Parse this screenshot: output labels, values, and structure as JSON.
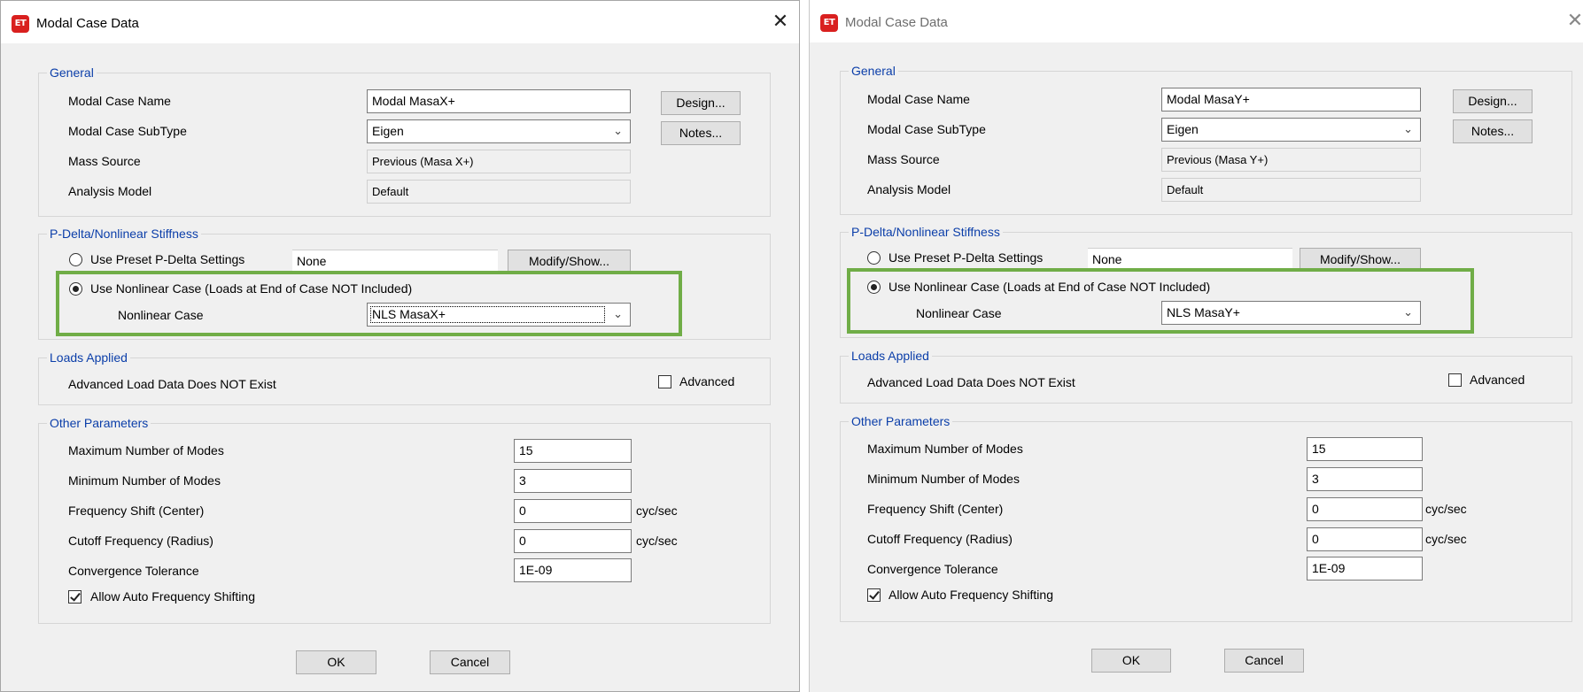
{
  "theme": {
    "legend_color": "#0b3ea9",
    "highlight_color": "#70ad47",
    "app_icon_color": "#d9201f"
  },
  "dialogs": [
    {
      "icon": "ET",
      "title": "Modal Case Data",
      "close": "✕",
      "general": {
        "legend": "General",
        "case_name_label": "Modal Case Name",
        "case_name": "Modal MasaX+",
        "subtype_label": "Modal Case SubType",
        "subtype": "Eigen",
        "mass_source_label": "Mass Source",
        "mass_source": "Previous  (Masa X+)",
        "analysis_model_label": "Analysis Model",
        "analysis_model": "Default",
        "design_button": "Design...",
        "notes_button": "Notes..."
      },
      "pdelta": {
        "legend": "P-Delta/Nonlinear Stiffness",
        "preset_label": "Use Preset P-Delta Settings",
        "preset_value": "None",
        "modify_button": "Modify/Show...",
        "nonlinear_label": "Use Nonlinear Case  (Loads at End of Case NOT Included)",
        "nonlinear_case_label": "Nonlinear Case",
        "nonlinear_case": "NLS MasaX+",
        "selected": "nonlinear"
      },
      "loads": {
        "legend": "Loads Applied",
        "status": "Advanced Load Data Does NOT Exist",
        "advanced_label": "Advanced",
        "advanced_checked": false
      },
      "other": {
        "legend": "Other Parameters",
        "max_modes_label": "Maximum Number of Modes",
        "max_modes": "15",
        "min_modes_label": "Minimum Number of Modes",
        "min_modes": "3",
        "freq_shift_label": "Frequency Shift  (Center)",
        "freq_shift": "0",
        "freq_shift_unit": "cyc/sec",
        "cutoff_label": "Cutoff Frequency  (Radius)",
        "cutoff": "0",
        "cutoff_unit": "cyc/sec",
        "tolerance_label": "Convergence Tolerance",
        "tolerance": "1E-09",
        "auto_shift_label": "Allow Auto Frequency Shifting",
        "auto_shift_checked": true
      },
      "ok_button": "OK",
      "cancel_button": "Cancel"
    },
    {
      "icon": "ET",
      "title": "Modal Case Data",
      "close": "✕",
      "general": {
        "legend": "General",
        "case_name_label": "Modal Case Name",
        "case_name": "Modal MasaY+",
        "subtype_label": "Modal Case SubType",
        "subtype": "Eigen",
        "mass_source_label": "Mass Source",
        "mass_source": "Previous  (Masa Y+)",
        "analysis_model_label": "Analysis Model",
        "analysis_model": "Default",
        "design_button": "Design...",
        "notes_button": "Notes..."
      },
      "pdelta": {
        "legend": "P-Delta/Nonlinear Stiffness",
        "preset_label": "Use Preset P-Delta Settings",
        "preset_value": "None",
        "modify_button": "Modify/Show...",
        "nonlinear_label": "Use Nonlinear Case  (Loads at End of Case NOT Included)",
        "nonlinear_case_label": "Nonlinear Case",
        "nonlinear_case": "NLS MasaY+",
        "selected": "nonlinear"
      },
      "loads": {
        "legend": "Loads Applied",
        "status": "Advanced Load Data Does NOT Exist",
        "advanced_label": "Advanced",
        "advanced_checked": false
      },
      "other": {
        "legend": "Other Parameters",
        "max_modes_label": "Maximum Number of Modes",
        "max_modes": "15",
        "min_modes_label": "Minimum Number of Modes",
        "min_modes": "3",
        "freq_shift_label": "Frequency Shift  (Center)",
        "freq_shift": "0",
        "freq_shift_unit": "cyc/sec",
        "cutoff_label": "Cutoff Frequency  (Radius)",
        "cutoff": "0",
        "cutoff_unit": "cyc/sec",
        "tolerance_label": "Convergence Tolerance",
        "tolerance": "1E-09",
        "auto_shift_label": "Allow Auto Frequency Shifting",
        "auto_shift_checked": true
      },
      "ok_button": "OK",
      "cancel_button": "Cancel"
    }
  ]
}
